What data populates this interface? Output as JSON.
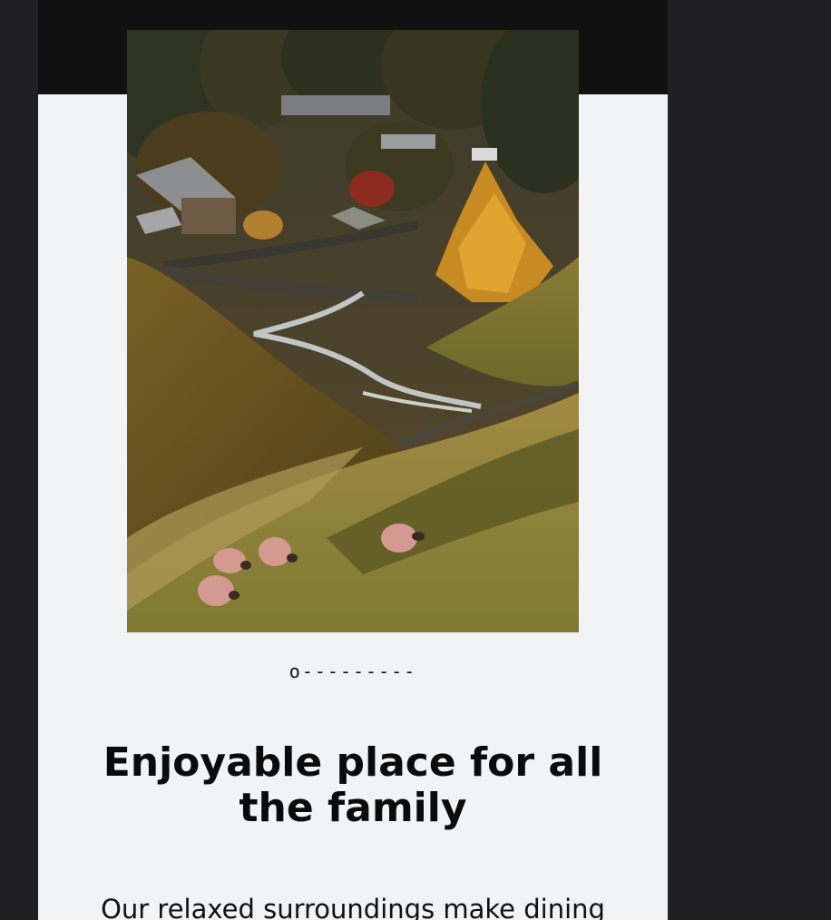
{
  "section": {
    "divider_glyph": "o---------",
    "headline": "Enjoyable place for all the family",
    "body_text": "Our relaxed surroundings make dining",
    "image_alt": "Valley with stream, village and grazing sheep"
  },
  "colors": {
    "page_background": "#202022",
    "card_background": "#f2f3f4",
    "top_band": "#111112",
    "text": "#0b0b0b"
  }
}
